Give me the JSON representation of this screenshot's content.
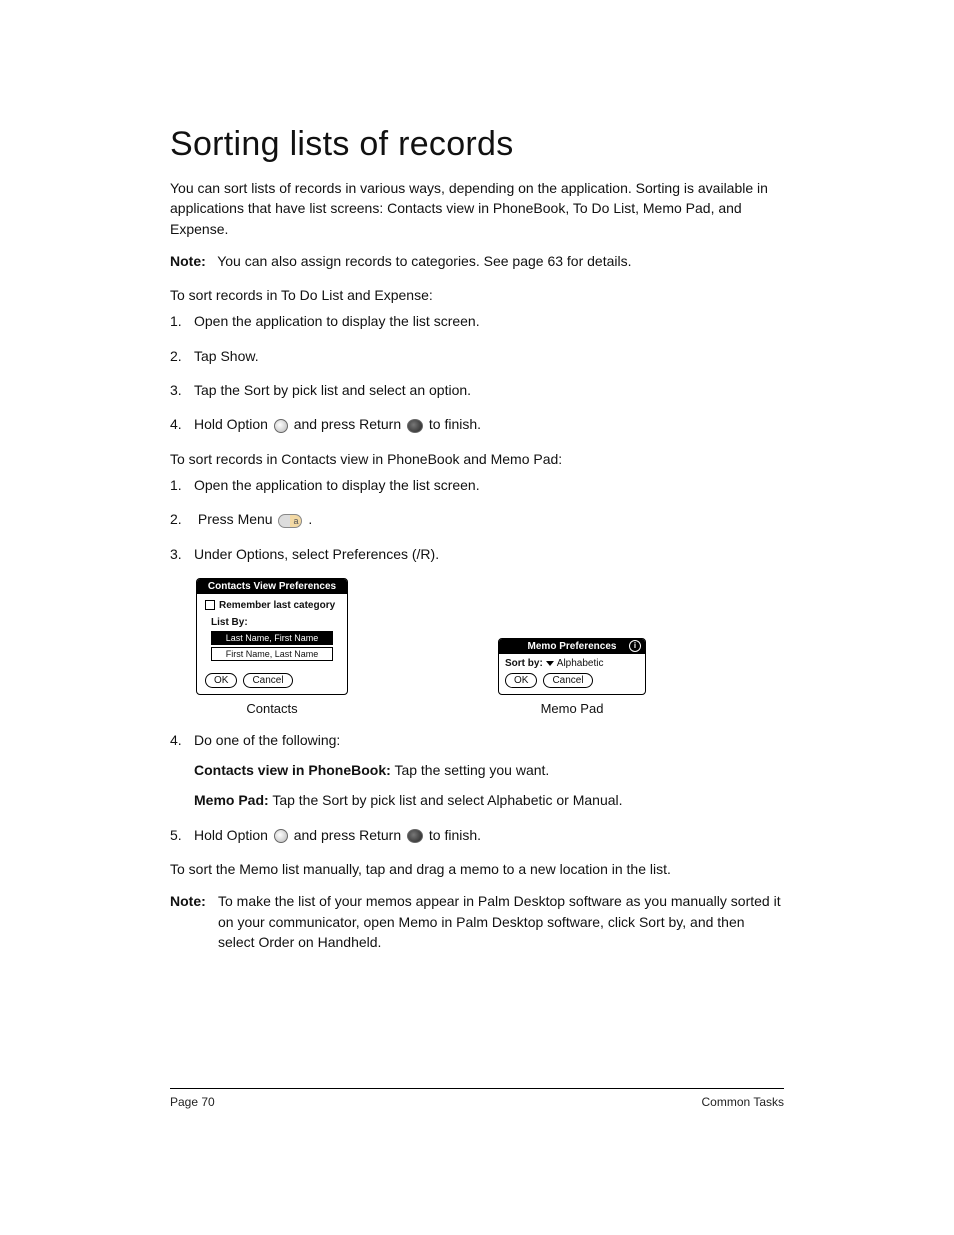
{
  "title": "Sorting lists of records",
  "intro": "You can sort lists of records in various ways, depending on the application. Sorting is available in applications that have list screens: Contacts view in PhoneBook, To Do List, Memo Pad, and Expense.",
  "note1Label": "Note:",
  "note1Text": "You can also assign records to categories. See page 63 for details.",
  "sectionA": "To sort records in To Do List and Expense:",
  "stepsA": [
    "Open the application to display the list screen.",
    "Tap Show.",
    "Tap the Sort by pick list and select an option."
  ],
  "stepA4_pre": "Hold Option",
  "stepA4_mid": "and press Return",
  "stepA4_post": "to finish.",
  "sectionB": "To sort records in Contacts view in PhoneBook and Memo Pad:",
  "stepB1": "Open the application to display the list screen.",
  "stepB2": "Press Menu",
  "stepB2_post": ".",
  "stepB3": "Under Options, select Preferences (/R).",
  "contactsDlg": {
    "title": "Contacts View Preferences",
    "remember": "Remember last category",
    "listByLabel": "List By:",
    "opt1": "Last Name, First Name",
    "opt2": "First Name, Last Name",
    "ok": "OK",
    "cancel": "Cancel"
  },
  "contactsCaption": "Contacts",
  "memoDlg": {
    "title": "Memo Preferences",
    "sortByLabel": "Sort by:",
    "sortByValue": "Alphabetic",
    "ok": "OK",
    "cancel": "Cancel"
  },
  "memoCaption": "Memo Pad",
  "stepB4": "Do one of the following:",
  "stepB4aLabel": "Contacts view in PhoneBook:",
  "stepB4aText": " Tap the setting you want.",
  "stepB4bLabel": "Memo Pad:",
  "stepB4bText": " Tap the Sort by pick list and select Alphabetic or Manual.",
  "stepB5_pre": "Hold Option",
  "stepB5_mid": "and press Return",
  "stepB5_post": "to finish.",
  "afterSteps": "To sort the Memo list manually, tap and drag a memo to a new location in the list.",
  "note2Label": "Note:",
  "note2Text": "To make the list of your memos appear in Palm Desktop software as you manually sorted it on your communicator, open Memo in Palm Desktop software, click Sort by, and then select Order on Handheld.",
  "footerLeft": "Page 70",
  "footerRight": "Common Tasks"
}
